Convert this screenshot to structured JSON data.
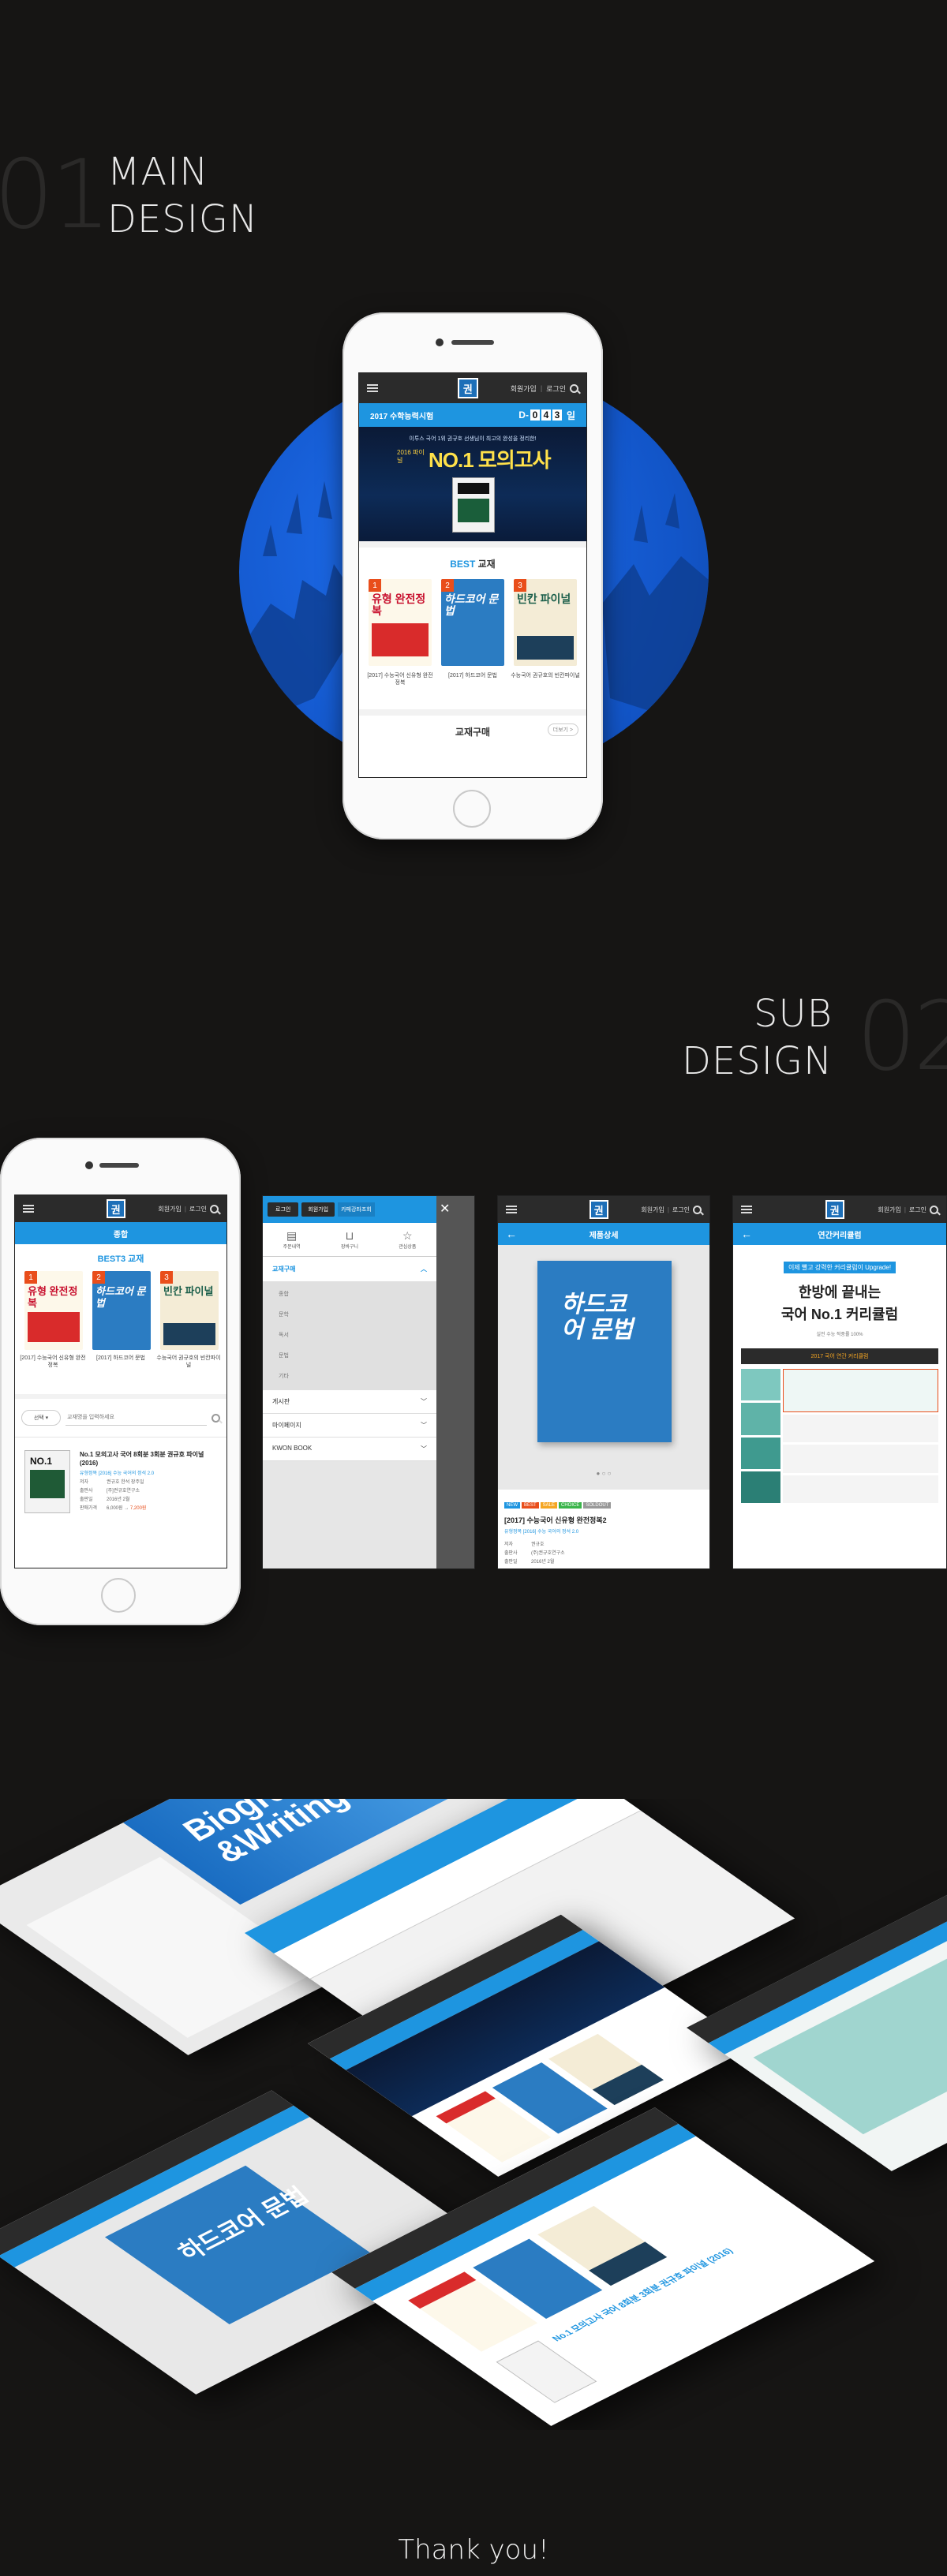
{
  "main": {
    "number": "01",
    "line1": "MAIN",
    "line2": "DESIGN"
  },
  "sub": {
    "number": "02",
    "line1": "SUB",
    "line2": "DESIGN"
  },
  "header": {
    "join": "회원가입",
    "login": "로그인"
  },
  "mainscreen": {
    "exam": "2017 수학능력시험",
    "dday_prefix": "D-",
    "dday_digits": [
      "0",
      "4",
      "3"
    ],
    "dday_suffix": "일",
    "banner_sub": "이투스 국어 1위 권규호 선생님이 최고의 완성을 정리한!",
    "banner_year": "2016 파이널",
    "banner_title": "NO.1 모의고사",
    "best_label": "BEST",
    "best_word": "교재",
    "books": [
      {
        "rank": "1",
        "title": "유형 완전정복",
        "caption": "[2017] 수능국어 신유형 완전정복"
      },
      {
        "rank": "2",
        "title": "하드코어 문법",
        "caption": "[2017] 하드코어 문법"
      },
      {
        "rank": "3",
        "title": "빈칸 파이널",
        "caption": "수능국어 권규호의 빈칸파이널"
      }
    ],
    "buy_label": "교재구매",
    "buy_more": "더보기 >"
  },
  "sub1": {
    "title": "종합",
    "best": "BEST3 교재",
    "select": "선택",
    "search_placeholder": "교재명을 입력하세요",
    "item_title": "No.1 모의고사 국어 8회분 3회분 권규호 파이널 (2016)",
    "item_sub": "유형정복 [2016] 수능 국어의 정석 2.0",
    "item_rows": [
      {
        "k": "저자",
        "v": "권규호 한석 장주일"
      },
      {
        "k": "출판사",
        "v": "[주]권규호연구소"
      },
      {
        "k": "출판일",
        "v": "2016년 2월"
      },
      {
        "k": "판매가격",
        "v": "6,000원"
      }
    ],
    "item_price": "7,200원"
  },
  "sub2": {
    "tabs": [
      "로그인",
      "회원가입",
      "카페강좌조회"
    ],
    "icons": [
      "주문내역",
      "장바구니",
      "관심상품"
    ],
    "menu_open": "교재구매",
    "menu_children": [
      "종합",
      "문학",
      "독서",
      "문법",
      "기타"
    ],
    "menu_rest": [
      "게시판",
      "마이페이지",
      "KWON BOOK"
    ]
  },
  "sub3": {
    "title": "제품상세",
    "book_title": "하드코어 문법",
    "tags": [
      "NEW",
      "BEST",
      "SALE",
      "CHOICE",
      "SOLDOUT"
    ],
    "product": "[2017] 수능국어 신유형 완전정복2",
    "product_sub": "유형정복 [2016] 수능 국어의 정석 2.0",
    "rows": [
      {
        "k": "저자",
        "v": "권규호"
      },
      {
        "k": "출판사",
        "v": "(주)권규호연구소"
      },
      {
        "k": "출판일",
        "v": "2016년 2월"
      }
    ]
  },
  "sub4": {
    "title": "연간커리큘럼",
    "highlight": "이제 빨고 강력한 커리큘럼이 Upgrade!",
    "line1": "한방에 끝내는",
    "line2": "국어 No.1 커리큘럼",
    "small": "실전 수능 적중률 100%",
    "ribbon": "2017 국어 연간 커리큘럼"
  },
  "thanks": "Thank you!",
  "colors": {
    "accent": "#1e95e0",
    "dark": "#2b2b2b",
    "bg": "#161514",
    "circle": "#1760d8"
  }
}
